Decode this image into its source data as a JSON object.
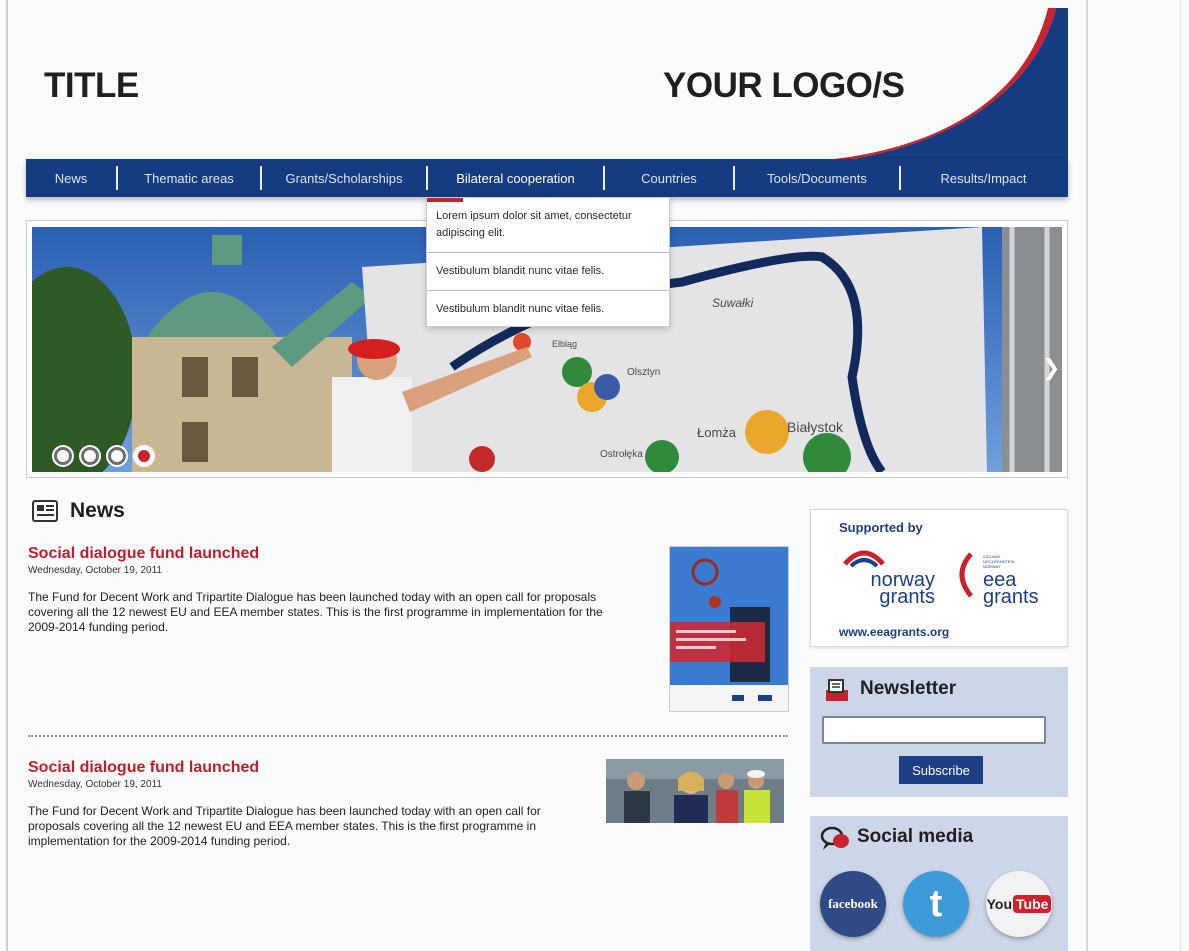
{
  "header": {
    "title": "TITLE",
    "logo": "YOUR LOGO/S",
    "brand_color": "#153b80",
    "accent_color": "#c8232c"
  },
  "nav": {
    "items": [
      {
        "label": "News"
      },
      {
        "label": "Thematic areas"
      },
      {
        "label": "Grants/Scholarships"
      },
      {
        "label": "Bilateral cooperation",
        "active": true
      },
      {
        "label": "Countries"
      },
      {
        "label": "Tools/Documents"
      },
      {
        "label": "Results/Impact"
      }
    ],
    "dropdown": [
      "Lorem ipsum dolor sit amet, consectetur adipiscing elit.",
      "Vestibulum blandit nunc vitae felis.",
      "Vestibulum blandit nunc vitae felis."
    ]
  },
  "slider": {
    "dot_count": 4,
    "active_dot": 4,
    "map_labels": [
      "Suwałki",
      "Olsztyn",
      "Elbląg",
      "Łomża",
      "Białystok",
      "Ostrołęka"
    ]
  },
  "news": {
    "heading": "News",
    "icon": "newspaper-icon",
    "articles": [
      {
        "title": "Social dialogue fund launched",
        "date": "Wednesday, October 19, 2011",
        "body": "The Fund for Decent Work and Tripartite Dialogue has been launched today with an open call for proposals covering all the 12 newest EU and EEA member states. This is the first programme in implementation for the 2009-2014 funding period."
      },
      {
        "title": "Social dialogue fund launched",
        "date": "Wednesday, October 19, 2011",
        "body": "The Fund for Decent Work and Tripartite Dialogue has been launched today with an open call for proposals covering all the 12 newest EU and EEA member states. This is the first programme in implementation for the 2009-2014 funding period."
      }
    ]
  },
  "sidebar": {
    "supported": {
      "heading": "Supported by",
      "norway_logo": "norway grants",
      "eea_logo": "eea grants",
      "eea_countries": "ICELAND LIECHTENSTEIN NORWAY",
      "url": "www.eeagrants.org"
    },
    "newsletter": {
      "heading": "Newsletter",
      "input_value": "",
      "button_label": "Subscribe"
    },
    "social": {
      "heading": "Social media",
      "facebook_label": "facebook",
      "twitter_glyph": "t",
      "youtube_you": "You",
      "youtube_tube": "Tube"
    }
  }
}
